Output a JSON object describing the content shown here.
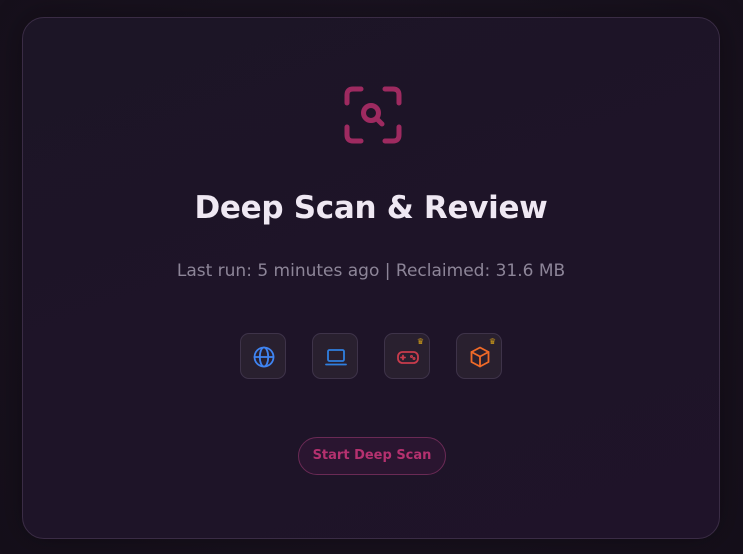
{
  "hero": {
    "icon": "scan-search-icon",
    "title": "Deep Scan & Review",
    "subtitle": "Last run: 5 minutes ago | Reclaimed: 31.6 MB"
  },
  "categories": [
    {
      "icon": "globe-icon",
      "premium": false,
      "color": "#3f84f2"
    },
    {
      "icon": "laptop-icon",
      "premium": false,
      "color": "#2f7fe0"
    },
    {
      "icon": "gamepad-icon",
      "premium": true,
      "color": "#c83b4c"
    },
    {
      "icon": "package-icon",
      "premium": true,
      "color": "#f06a28"
    }
  ],
  "premium_badge": {
    "icon": "crown-icon",
    "color": "#d4a017"
  },
  "action": {
    "label": "Start Deep Scan"
  },
  "colors": {
    "accent": "#a2285f",
    "background": "#17111c",
    "card": "#1e1428",
    "title": "#efe8f3",
    "subtitle": "#8d8598"
  }
}
